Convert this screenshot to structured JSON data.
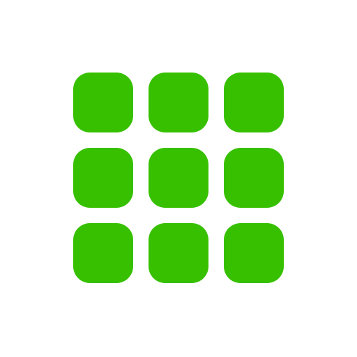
{
  "icon": {
    "name": "grid-icon",
    "background_color": "#ffffff",
    "tile_color": "#37c000",
    "rows": 3,
    "columns": 3
  }
}
